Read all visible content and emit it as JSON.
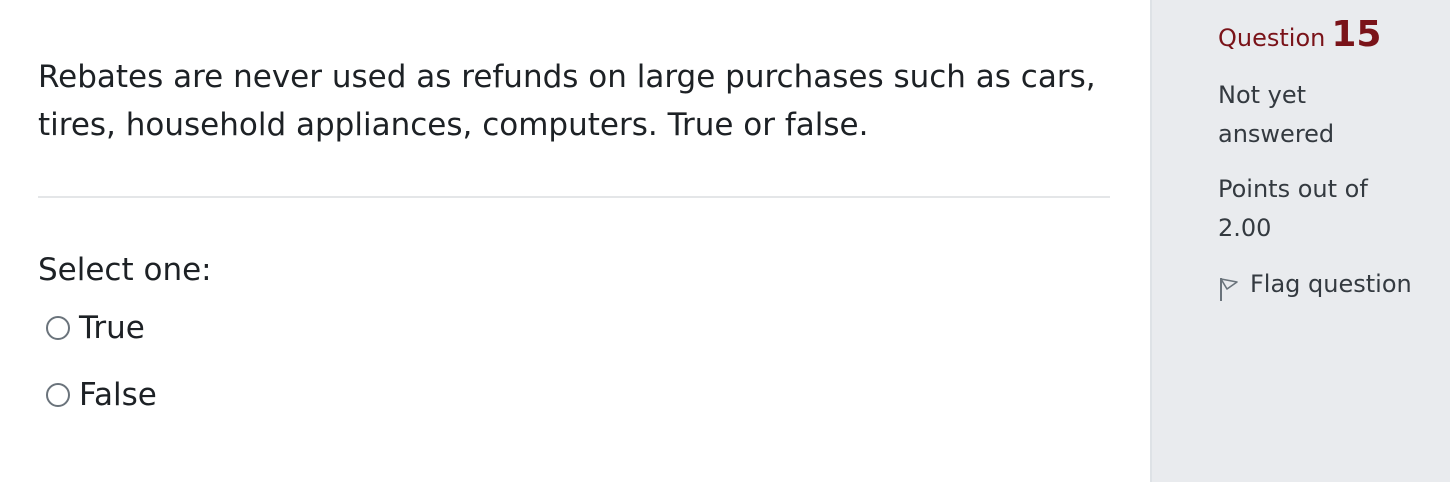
{
  "question": {
    "text": "Rebates are never used as refunds on large purchases such as cars, tires, household appliances, computers. True or false.",
    "prompt": "Select one:",
    "options": [
      {
        "label": "True",
        "selected": false
      },
      {
        "label": "False",
        "selected": false
      }
    ]
  },
  "info": {
    "question_word": "Question",
    "number": "15",
    "state": "Not yet answered",
    "grade": "Points out of 2.00",
    "flag_label": "Flag question",
    "flag_icon": "flag-outline-icon"
  },
  "colors": {
    "question_number": "#7a1319",
    "sidebar_bg": "#e9ebee",
    "text": "#1d2125"
  }
}
